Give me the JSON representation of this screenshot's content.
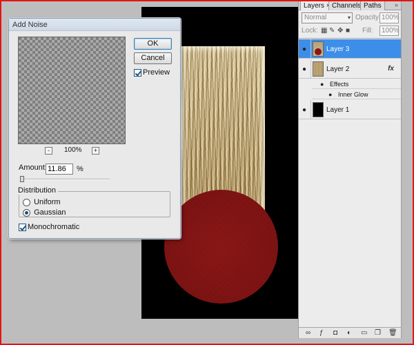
{
  "dialog": {
    "title": "Add Noise",
    "ok_label": "OK",
    "cancel_label": "Cancel",
    "preview_label": "Preview",
    "preview_checked": true,
    "zoom_minus": "-",
    "zoom_plus": "+",
    "zoom_level": "100%",
    "amount_label": "Amount:",
    "amount_value": "11.86",
    "amount_unit": "%",
    "distribution_label": "Distribution",
    "distribution_options": [
      "Uniform",
      "Gaussian"
    ],
    "distribution_selected": "Gaussian",
    "monochromatic_label": "Monochromatic",
    "monochromatic_checked": true
  },
  "panel": {
    "tabs": [
      {
        "label": "Layers ×",
        "active": true
      },
      {
        "label": "Channels",
        "active": false
      },
      {
        "label": "Paths",
        "active": false
      }
    ],
    "menu_icon": "»",
    "blend_mode": "Normal",
    "blend_arrow": "▾",
    "opacity_label": "Opacity:",
    "opacity_value": "100%",
    "lock_label": "Lock:",
    "fill_label": "Fill:",
    "fill_value": "100%",
    "layers": [
      {
        "name": "Layer 3",
        "selected": true
      },
      {
        "name": "Layer 2",
        "selected": false,
        "fx": "fx"
      },
      {
        "name": "Layer 1",
        "selected": false
      }
    ],
    "effects_label": "Effects",
    "inner_glow_label": "Inner Glow"
  },
  "colors": {
    "accent_selected": "#3d8ee8",
    "circle_red": "#8b1616",
    "border_red": "#e31414"
  }
}
